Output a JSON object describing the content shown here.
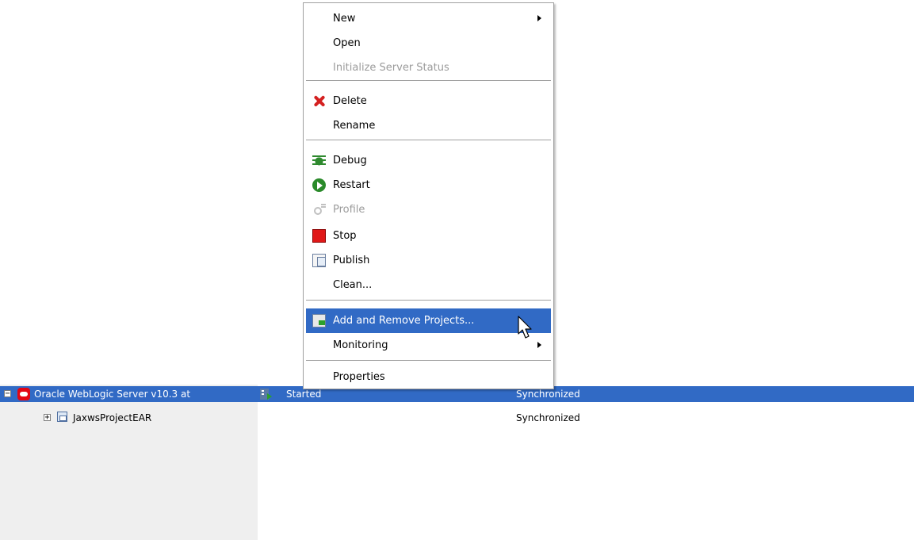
{
  "context_menu": {
    "items": [
      {
        "label": "New",
        "icon": "",
        "disabled": false,
        "submenu": true
      },
      {
        "label": "Open",
        "icon": "",
        "disabled": false,
        "submenu": false
      },
      {
        "label": "Initialize Server Status",
        "icon": "",
        "disabled": true,
        "submenu": false
      },
      {
        "label": "Delete",
        "icon": "delete-icon",
        "disabled": false,
        "submenu": false
      },
      {
        "label": "Rename",
        "icon": "",
        "disabled": false,
        "submenu": false
      },
      {
        "label": "Debug",
        "icon": "debug-icon",
        "disabled": false,
        "submenu": false
      },
      {
        "label": "Restart",
        "icon": "restart-icon",
        "disabled": false,
        "submenu": false
      },
      {
        "label": "Profile",
        "icon": "profile-icon",
        "disabled": true,
        "submenu": false
      },
      {
        "label": "Stop",
        "icon": "stop-icon",
        "disabled": false,
        "submenu": false
      },
      {
        "label": "Publish",
        "icon": "publish-icon",
        "disabled": false,
        "submenu": false
      },
      {
        "label": "Clean...",
        "icon": "",
        "disabled": false,
        "submenu": false
      },
      {
        "label": "Add and Remove Projects...",
        "icon": "add-remove-projects-icon",
        "disabled": false,
        "submenu": false,
        "highlighted": true
      },
      {
        "label": "Monitoring",
        "icon": "",
        "disabled": false,
        "submenu": true
      },
      {
        "label": "Properties",
        "icon": "",
        "disabled": false,
        "submenu": false
      }
    ]
  },
  "servers": {
    "rows": [
      {
        "name": "Oracle WebLogic Server v10.3 at",
        "state": "Started",
        "status": "Synchronized",
        "expanded": true,
        "selected": true,
        "icon": "oracle-server-icon"
      },
      {
        "name": "JaxwsProjectEAR",
        "state": "",
        "status": "Synchronized",
        "expanded": false,
        "selected": false,
        "icon": "ear-project-icon"
      }
    ]
  },
  "colors": {
    "selection": "#316ac5",
    "disabled_text": "#9b9b9b",
    "oracle_red": "#e30613"
  }
}
